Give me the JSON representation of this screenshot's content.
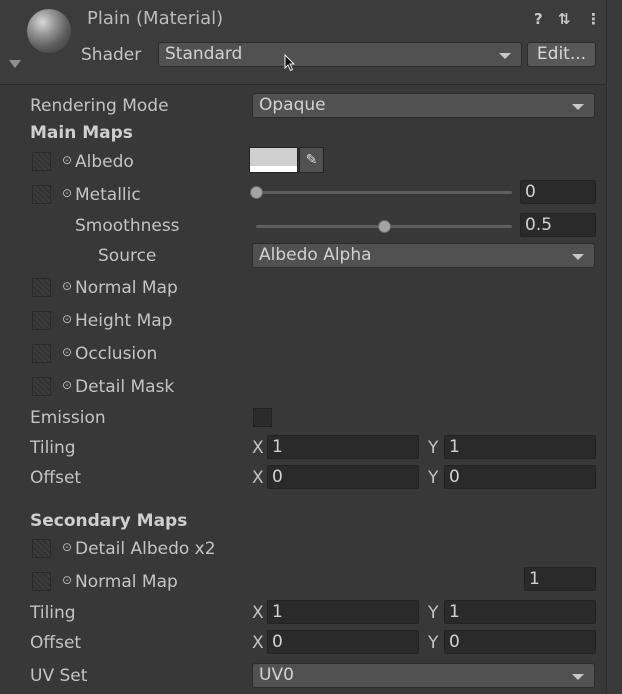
{
  "header": {
    "title": "Plain (Material)",
    "shader_label": "Shader",
    "shader_value": "Standard",
    "edit_label": "Edit...",
    "icons": [
      "help-icon",
      "settings-sliders-icon",
      "more-vert-icon"
    ]
  },
  "rendering_mode": {
    "label": "Rendering Mode",
    "value": "Opaque"
  },
  "main_maps": {
    "heading": "Main Maps",
    "albedo": {
      "label": "Albedo",
      "color": "#ffffff"
    },
    "metallic": {
      "label": "Metallic",
      "value": "0",
      "fraction": 0.0
    },
    "smoothness": {
      "label": "Smoothness",
      "value": "0.5",
      "fraction": 0.5
    },
    "source": {
      "label": "Source",
      "value": "Albedo Alpha"
    },
    "normal_map": {
      "label": "Normal Map"
    },
    "height_map": {
      "label": "Height Map"
    },
    "occlusion": {
      "label": "Occlusion"
    },
    "detail_mask": {
      "label": "Detail Mask"
    },
    "emission": {
      "label": "Emission"
    },
    "tiling": {
      "label": "Tiling",
      "x_label": "X",
      "x": "1",
      "y_label": "Y",
      "y": "1"
    },
    "offset": {
      "label": "Offset",
      "x_label": "X",
      "x": "0",
      "y_label": "Y",
      "y": "0"
    }
  },
  "secondary_maps": {
    "heading": "Secondary Maps",
    "detail_albedo": {
      "label": "Detail Albedo x2"
    },
    "normal_map": {
      "label": "Normal Map",
      "scale": "1"
    },
    "tiling": {
      "label": "Tiling",
      "x_label": "X",
      "x": "1",
      "y_label": "Y",
      "y": "1"
    },
    "offset": {
      "label": "Offset",
      "x_label": "X",
      "x": "0",
      "y_label": "Y",
      "y": "0"
    },
    "uv_set": {
      "label": "UV Set",
      "value": "UV0"
    }
  },
  "colors": {
    "background": "#383838",
    "field": "#2a2a2a",
    "dropdown": "#515151"
  }
}
